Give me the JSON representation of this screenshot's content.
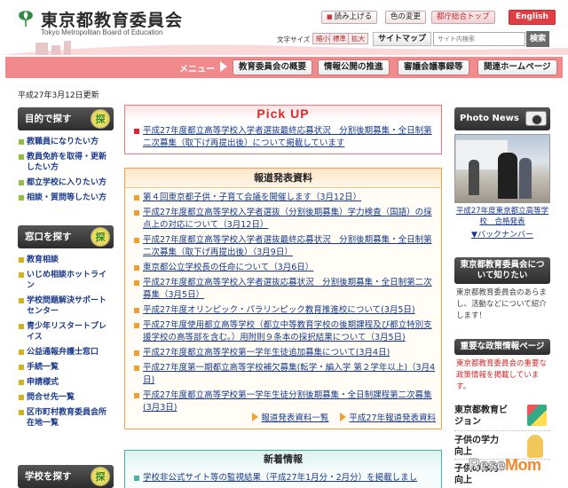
{
  "header": {
    "title": "東京都教育委員会",
    "subtitle": "Tokyo Metropolitan Board of Education",
    "buttons": {
      "read_aloud": "読み上げる",
      "color_change": "色の変更",
      "metro_top": "都庁総合トップ",
      "english": "English"
    },
    "text_size": {
      "label": "文字サイズ",
      "small": "縮小",
      "standard": "標準",
      "large": "拡大"
    },
    "sitemap": "サイトマップ",
    "search": {
      "placeholder": "サイト内検索",
      "button": "検索"
    }
  },
  "menu": {
    "label": "メニュー",
    "items": [
      "教育委員会の概要",
      "情報公開の推進",
      "審議会議事録等",
      "関連ホームページ"
    ]
  },
  "updated": "平成27年3月12日更新",
  "left_nav": [
    {
      "title": "目的で探す",
      "items": [
        "教職員になりたい方",
        "教員免許を取得・更新したい方",
        "都立学校に入りたい方",
        "相談・質問等したい方"
      ]
    },
    {
      "title": "窓口を探す",
      "items": [
        "教育相談",
        "いじめ相談ホットライン",
        "学校問題解決サポートセンター",
        "青少年リスタートプレイス",
        "公益通報弁護士窓口",
        "手続一覧",
        "申請様式",
        "問合せ先一覧",
        "区市町村教育委員会所在地一覧"
      ]
    },
    {
      "title": "学校を探す",
      "items": []
    }
  ],
  "pickup": {
    "title": "Pick UP",
    "item": "平成27年度都立高等学校入学者選抜最終応募状況　分割後期募集・全日制第二次募集（取下げ再提出後）について掲載しています"
  },
  "press": {
    "title": "報道発表資料",
    "items": [
      "第４回東京都子供・子育て会議を開催します（3月12日）",
      "平成27年度都立高等学校入学者選抜（分割後期募集）学力検査（国語）の採点上の対応について（3月12日）",
      "平成27年度都立高等学校入学者選抜最終応募状況　分割後期募集・全日制第二次募集（取下げ再提出後）（3月9日）",
      "東京都公立学校長の任命について（3月6日）",
      "平成27年度都立高等学校入学者選抜応募状況　分割後期募集・全日制第二次募集（3月5日）",
      "平成27年度オリンピック・パラリンピック教育推進校について(3月5日)",
      "平成27年度使用都立高等学校（都立中等教育学校の後期課程及び都立特別支援学校の高等部を含む。）用附則９条本の採択結果について（3月5日)",
      "平成27年度都立高等学校第一学年生徒追加募集について(3月4日)",
      "平成27年度第一期都立高等学校補欠募集(転学・編入学 第２学年以上)（3月4日)",
      "平成27年度都立高等学校第一学年生徒分割後期募集・全日制課程第二次募集(3月3日)"
    ],
    "footer_links": [
      "報道発表資料一覧",
      "平成27年報道発表資料"
    ]
  },
  "news": {
    "title": "新着情報",
    "item": "学校非公式サイト等の監視結果（平成27年1月分・2月分）を掲載しまし"
  },
  "right": {
    "photo_news_title": "Photo News",
    "photo_caption": "平成27年度東京都立高等学校　合格発表",
    "back_number": "▼バックナンバー",
    "about_box": {
      "title": "東京都教育委員会について知りたい",
      "body": "東京都教育委員会のあらまし、活動などについて紹介します！"
    },
    "policy_box": {
      "title": "重要な政策情報ページ",
      "body": "東京都教育委員会の重要な政策情報を掲載しています。"
    },
    "vision": "東京都教育ビジョン",
    "academic": "子供の学力向上",
    "physical": "子供の体力向上"
  },
  "watermark": {
    "prefix": "Rese",
    "suffix": "Mom"
  },
  "colors": {
    "menu_bar": "#f08a8c",
    "pickup_red": "#e2262b",
    "press_orange": "#f0a24a",
    "news_teal": "#46b3a3"
  }
}
